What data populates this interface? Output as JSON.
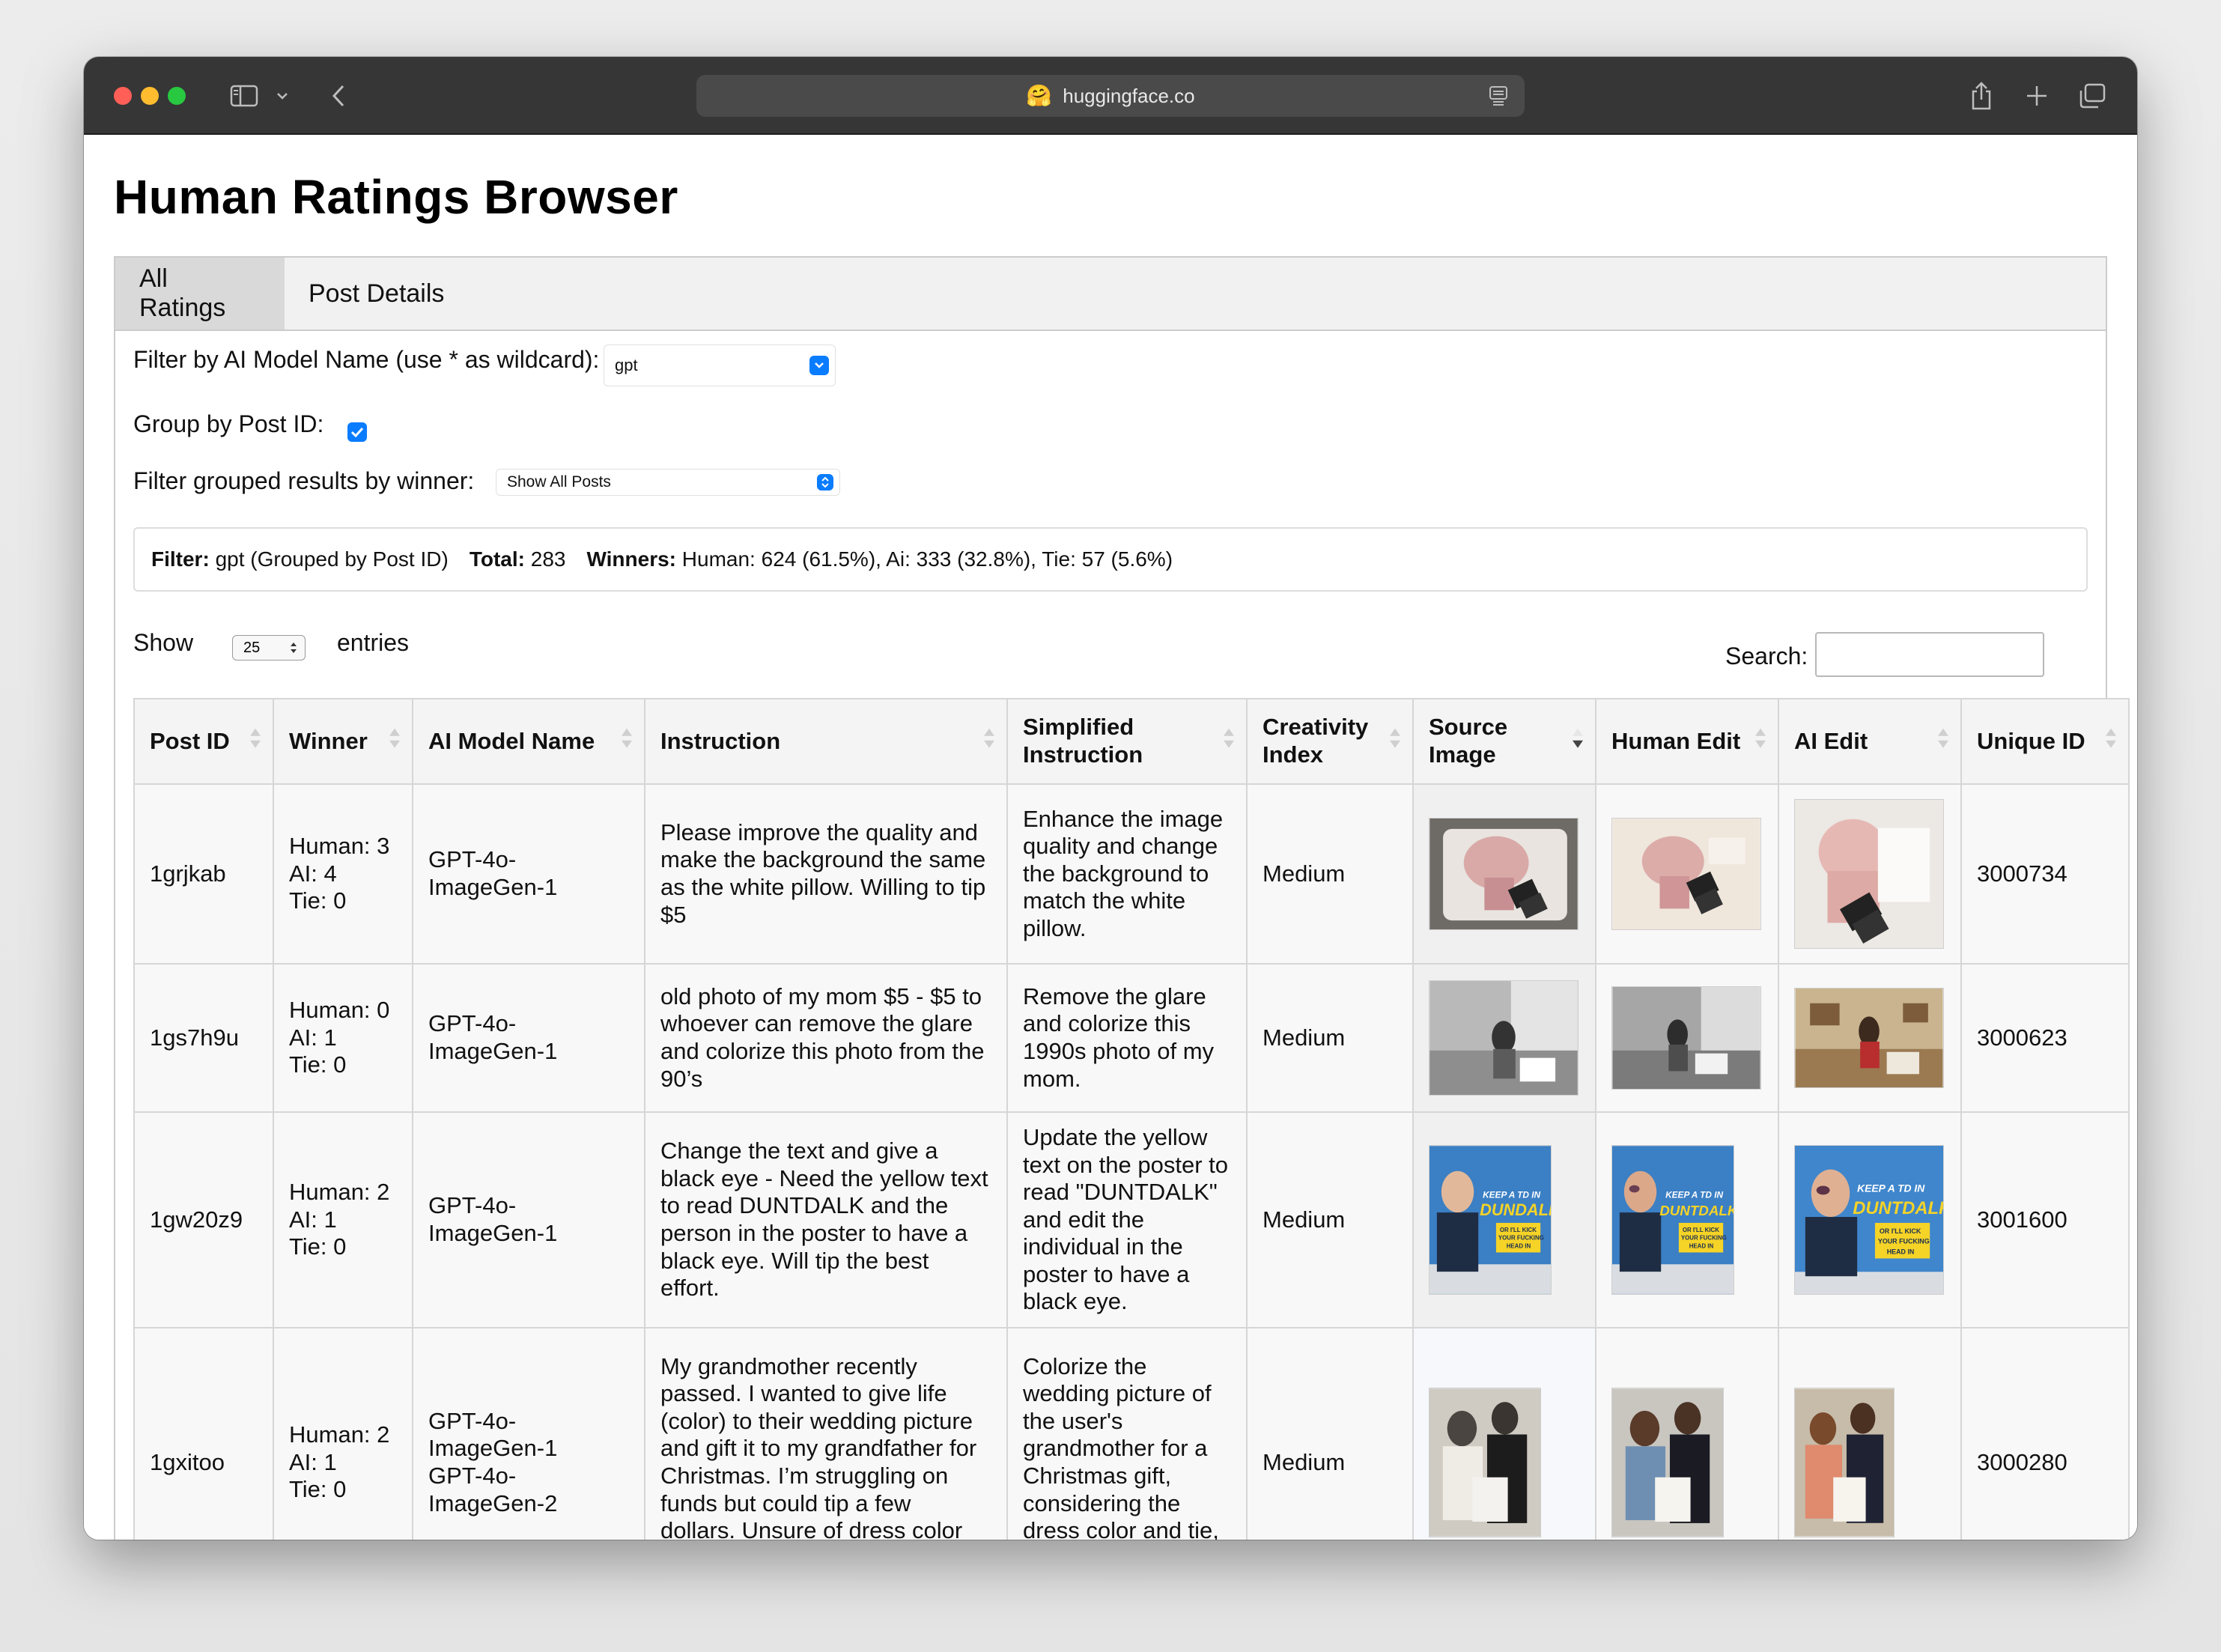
{
  "browser": {
    "url": "huggingface.co",
    "favicon": "🤗"
  },
  "page": {
    "title": "Human Ratings Browser",
    "tabs": [
      {
        "label": "All Ratings"
      },
      {
        "label": "Post Details"
      }
    ]
  },
  "filters": {
    "model_label": "Filter by AI Model Name (use * as wildcard):",
    "model_value": "gpt",
    "group_label": "Group by Post ID:",
    "group_checked": true,
    "winner_label": "Filter grouped results by winner:",
    "winner_value": "Show All Posts"
  },
  "summary": {
    "filter_key": "Filter:",
    "filter_value": "gpt (Grouped by Post ID)",
    "total_key": "Total:",
    "total_value": "283",
    "winners_key": "Winners:",
    "winners_value": "Human: 624 (61.5%), Ai: 333 (32.8%), Tie: 57 (5.6%)"
  },
  "table_controls": {
    "show_label": "Show",
    "entries_value": "25",
    "entries_label": "entries",
    "search_label": "Search:",
    "search_value": ""
  },
  "table": {
    "headers": [
      "Post ID",
      "Winner",
      "AI Model Name",
      "Instruction",
      "Simplified Instruction",
      "Creativity Index",
      "Source Image",
      "Human Edit",
      "AI Edit",
      "Unique ID"
    ],
    "rows": [
      {
        "post_id": "1grjkab",
        "winner": "Human: 3\nAI: 4\nTie: 0",
        "model": "GPT-4o-\nImageGen-1",
        "instruction": "Please improve the quality and make the background the same as the white pillow. Willing to tip $5",
        "simplified": "Enhance the image quality and change the background to match the white pillow.",
        "creativity": "Medium",
        "unique_id": "3000734"
      },
      {
        "post_id": "1gs7h9u",
        "winner": "Human: 0\nAI: 1\nTie: 0",
        "model": "GPT-4o-\nImageGen-1",
        "instruction": "old photo of my mom $5 - $5 to whoever can remove the glare and colorize this photo from the 90’s",
        "simplified": "Remove the glare and colorize this 1990s photo of my mom.",
        "creativity": "Medium",
        "unique_id": "3000623"
      },
      {
        "post_id": "1gw20z9",
        "winner": "Human: 2\nAI: 1\nTie: 0",
        "model": "GPT-4o-\nImageGen-1",
        "instruction": "Change the text and give a black eye - Need the yellow text to read DUNTDALK and the person in the poster to have a black eye. Will tip the best effort.",
        "simplified": "Update the yellow text on the poster to read \"DUNTDALK\" and edit the individual in the poster to have a black eye.",
        "creativity": "Medium",
        "unique_id": "3001600",
        "poster_lines": [
          "KEEP A TD IN",
          "DUNDALK",
          "DUNTDALK",
          "OR I'LL KICK",
          "YOUR FUCKING",
          "HEAD IN"
        ]
      },
      {
        "post_id": "1gxitoo",
        "winner": "Human: 2\nAI: 1\nTie: 0",
        "model": "GPT-4o-\nImageGen-1\nGPT-4o-\nImageGen-2",
        "instruction": "My grandmother recently passed. I wanted to give life (color) to their wedding picture and gift it to my grandfather for Christmas. I’m struggling on funds but could tip a few dollars. Unsure of dress color and tie.",
        "simplified": "Colorize the wedding picture of the user's grandmother for a Christmas gift, considering the dress color and tie, and working within",
        "creativity": "Medium",
        "unique_id": "3000280"
      }
    ]
  },
  "colors": {
    "accent": "#0a7cff",
    "header_bg": "#f4f4f4",
    "border": "#d6d6d6",
    "titlebar": "#363636"
  }
}
